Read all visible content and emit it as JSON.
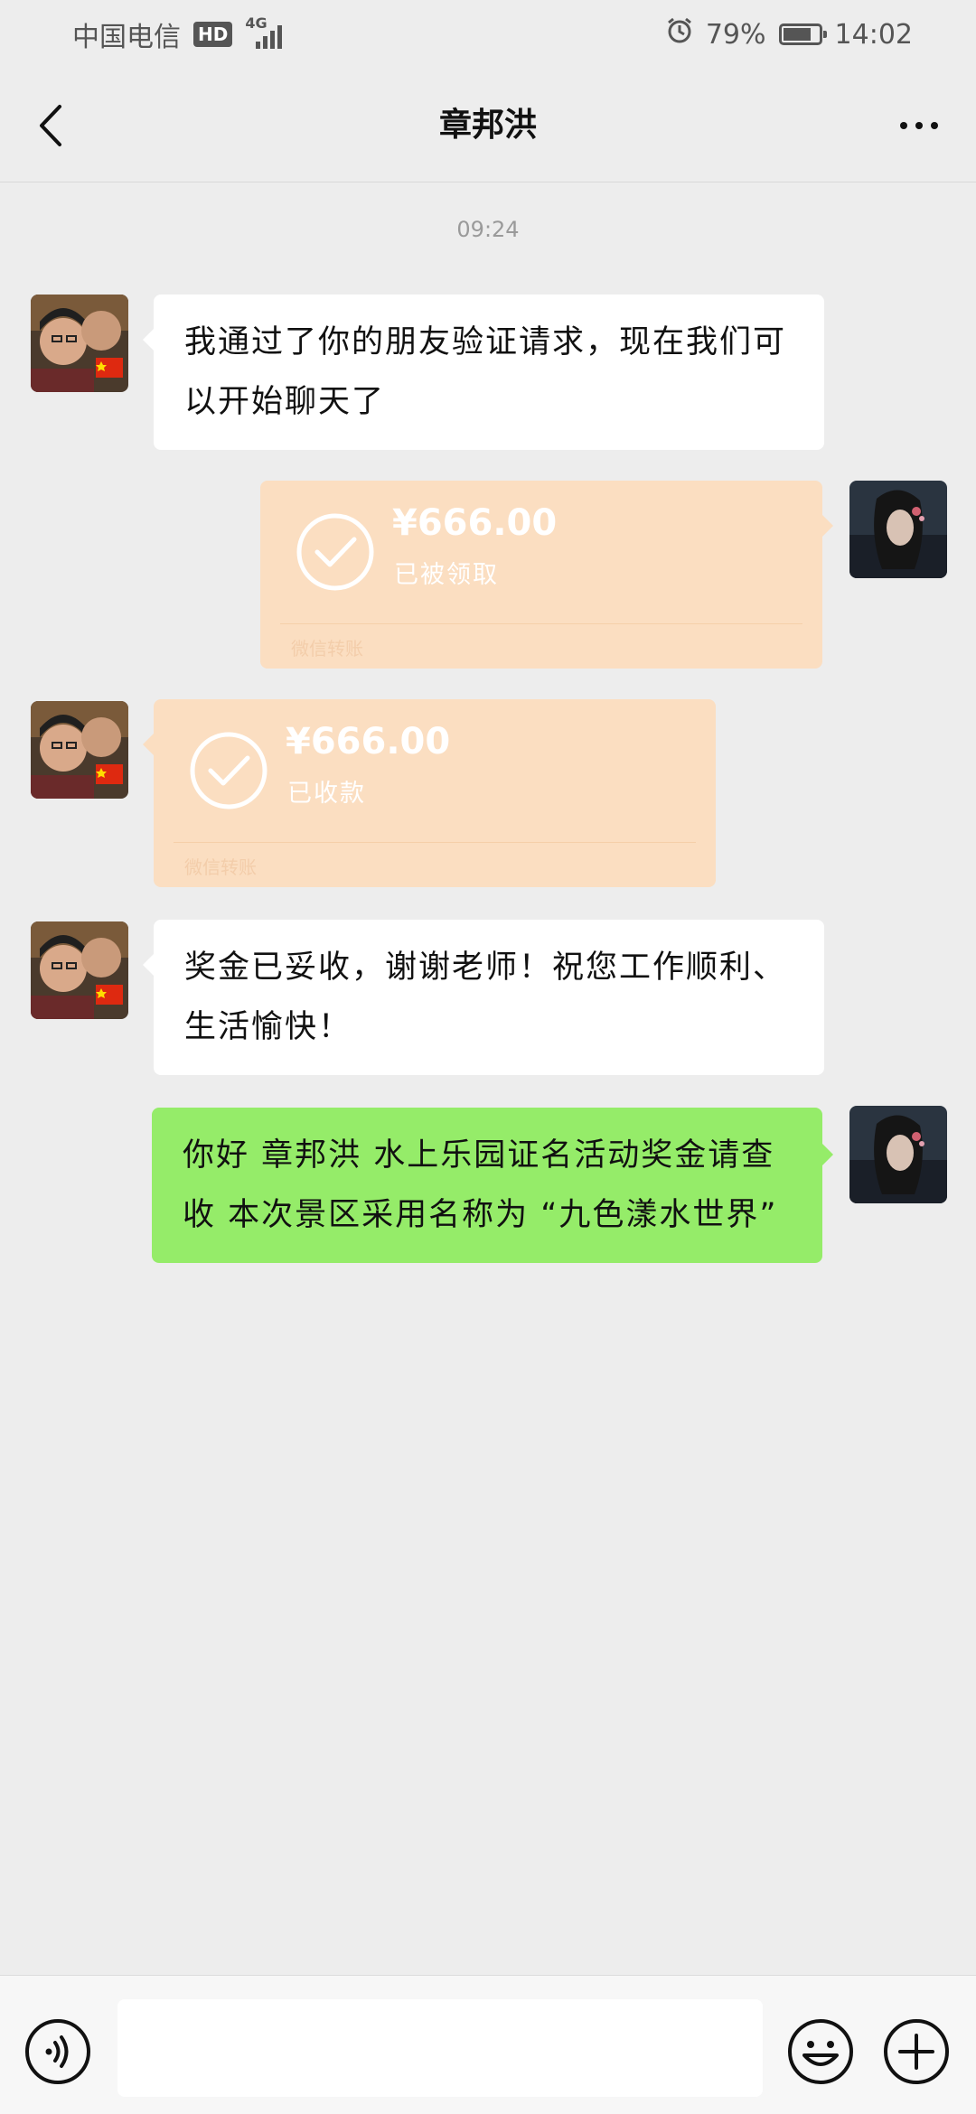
{
  "status_bar": {
    "carrier": "中国电信",
    "hd": "HD",
    "network": "4G",
    "battery_percent": "79%",
    "battery_level": 0.79,
    "time": "14:02",
    "icons": [
      "alarm-icon",
      "signal-icon",
      "battery-icon"
    ]
  },
  "header": {
    "title": "章邦洪",
    "back_icon": "chevron-left-icon",
    "more_icon": "more-icon"
  },
  "timestamp": "09:24",
  "messages": [
    {
      "sender": "contact",
      "type": "text",
      "text": "我通过了你的朋友验证请求，现在我们可以开始聊天了"
    },
    {
      "sender": "me",
      "type": "transfer",
      "amount": "¥666.00",
      "status": "已被领取",
      "label": "微信转账"
    },
    {
      "sender": "contact",
      "type": "transfer",
      "amount": "¥666.00",
      "status": "已收款",
      "label": "微信转账"
    },
    {
      "sender": "contact",
      "type": "text",
      "text": "奖金已妥收，谢谢老师！祝您工作顺利、生活愉快！"
    },
    {
      "sender": "me",
      "type": "text",
      "text": "你好 章邦洪 水上乐园证名活动奖金请查收 本次景区采用名称为 “九色漾水世界”"
    }
  ],
  "input_bar": {
    "placeholder": "",
    "icons": [
      "voice-icon",
      "emoji-icon",
      "plus-icon"
    ]
  },
  "colors": {
    "background": "#ededed",
    "bubble_in": "#ffffff",
    "bubble_out": "#95ec69",
    "transfer": "#fbdec1",
    "text": "#111111"
  }
}
